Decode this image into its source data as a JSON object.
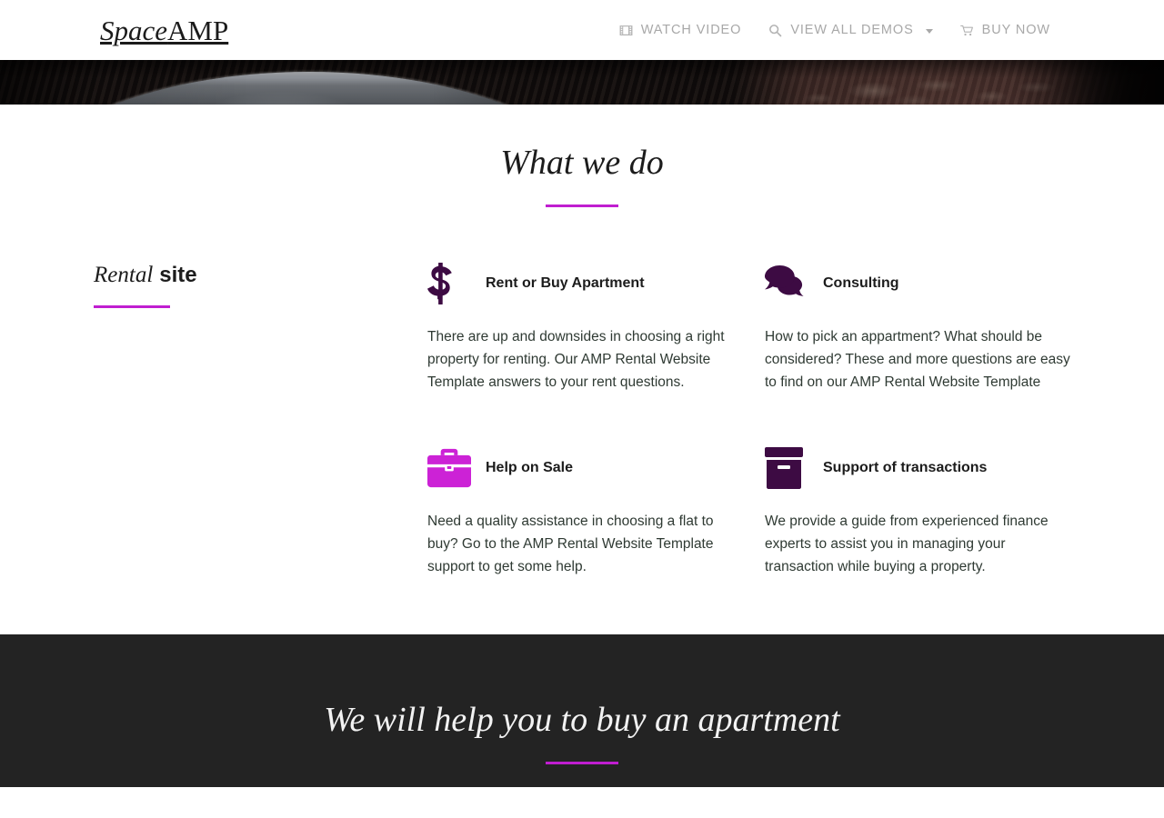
{
  "theme": {
    "accent": "#c01ed0",
    "icon_dark_purple": "#3d0b43",
    "icon_magenta": "#cc22d6",
    "dark_section_bg": "#232323",
    "body_text": "#2f3a33",
    "nav_text": "#a8a8a8"
  },
  "header": {
    "brand": {
      "part_italic": "Space",
      "part_regular": "AMP"
    },
    "nav": [
      {
        "label": "WATCH VIDEO",
        "icon": "film-strip-icon",
        "has_caret": false
      },
      {
        "label": "VIEW ALL DEMOS",
        "icon": "search-icon",
        "has_caret": true
      },
      {
        "label": "BUY NOW",
        "icon": "shopping-cart-icon",
        "has_caret": false
      }
    ]
  },
  "services": {
    "heading": "What we do",
    "left_column": {
      "title_italic": "Rental",
      "title_bold": "site"
    },
    "cards": [
      {
        "icon": "dollar-sign-icon",
        "title": "Rent or Buy Apartment",
        "text": "There are up and downsides in choosing a right property for renting. Our AMP Rental Website Template answers to your rent questions."
      },
      {
        "icon": "speech-bubbles-icon",
        "title": "Consulting",
        "text": "How to pick an appartment? What should be considered? These and more questions are easy to find on our AMP Rental Website Template"
      },
      {
        "icon": "briefcase-icon",
        "title": "Help on Sale",
        "text": "Need a quality assistance in choosing a flat to buy? Go to the AMP Rental Website Template support to get some help."
      },
      {
        "icon": "archive-box-icon",
        "title": "Support of transactions",
        "text": "We provide a guide from experienced finance experts to assist you in managing your transaction while buying a property."
      }
    ]
  },
  "cta": {
    "heading": "We will help you to buy an apartment"
  }
}
